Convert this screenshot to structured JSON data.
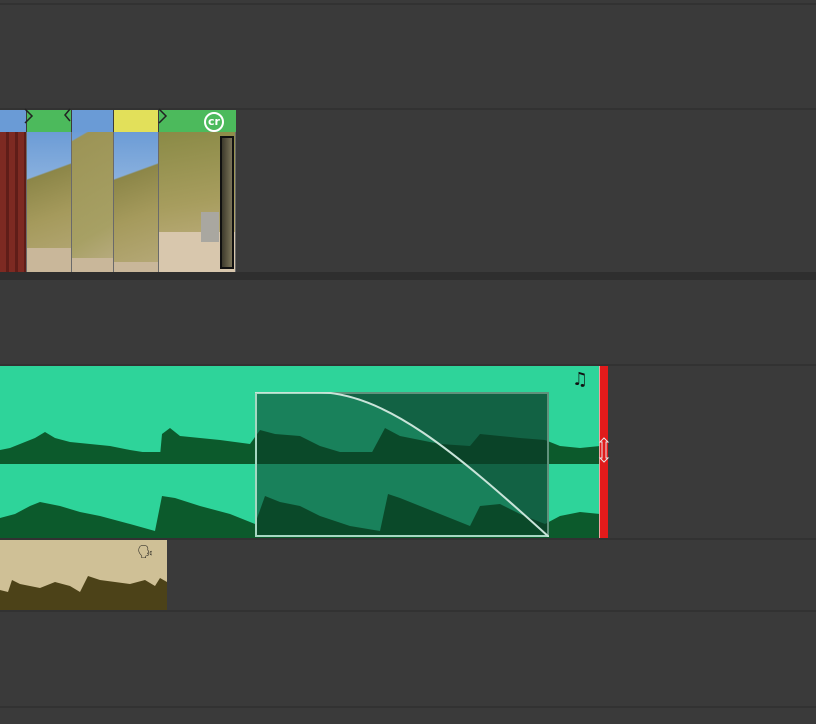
{
  "timeline": {
    "video_track": {
      "clip_badge_text": "cr",
      "clip_badge_icon": "cr-badge-icon",
      "marker_colors": [
        "#6a9bd6",
        "#4cba5c",
        "#6a9bd6",
        "#e2e05a",
        "#4cba5c"
      ]
    },
    "music_track": {
      "icon": "music-note-icon",
      "icon_glyph": "♫",
      "clip_color": "#2ed49a",
      "waveform_color": "#0c5a2c",
      "selection_color": "#1a7a52",
      "playhead_color": "#e21b1b"
    },
    "voice_track": {
      "icon": "speaker-voice-icon",
      "icon_glyph": "🗣",
      "clip_color": "#cfc096",
      "waveform_color": "#4c4218"
    }
  }
}
